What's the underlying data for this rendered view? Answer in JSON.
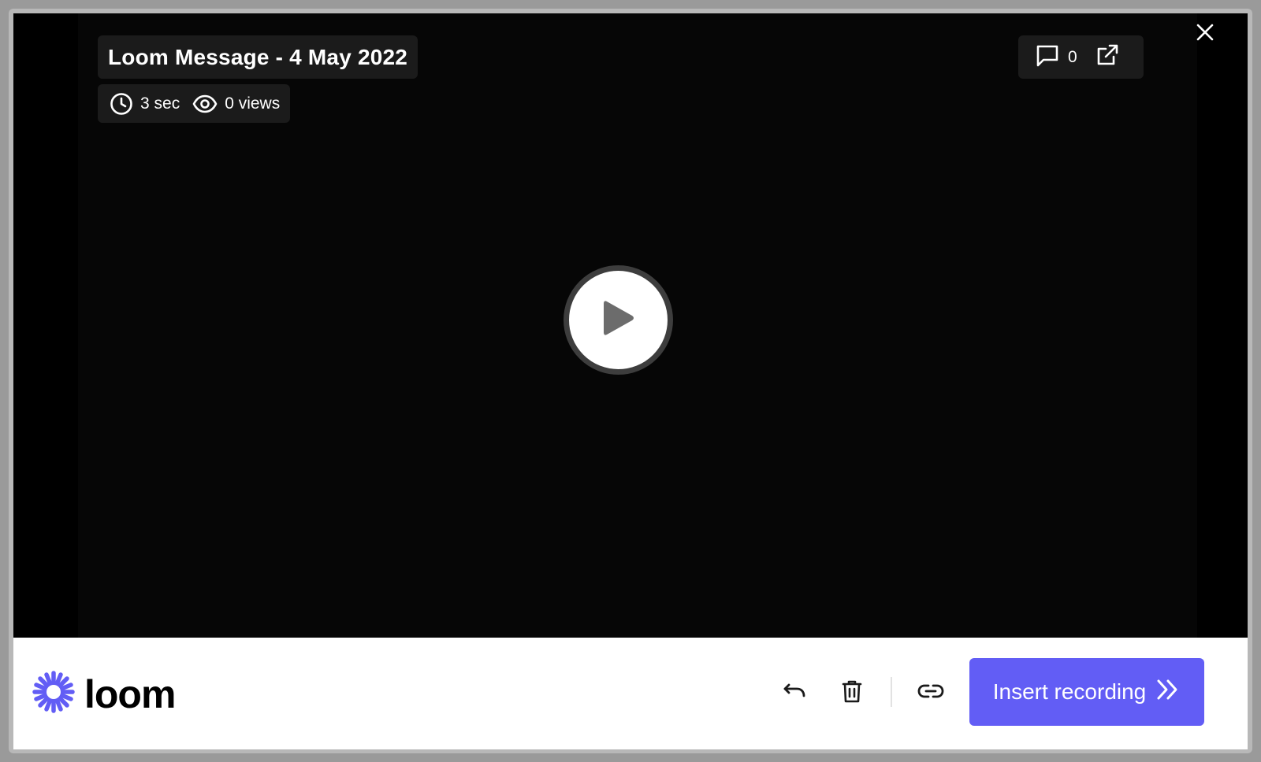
{
  "video": {
    "title": "Loom Message - 4 May 2022",
    "duration": "3 sec",
    "views": "0 views",
    "comment_count": "0"
  },
  "icons": {
    "close": "close-icon",
    "duration": "clock-icon",
    "views": "eye-icon",
    "comments": "comment-icon",
    "open_external": "external-link-icon",
    "play": "play-icon",
    "undo": "undo-icon",
    "delete": "trash-icon",
    "copy_link": "link-icon",
    "insert": "double-chevron-right-icon"
  },
  "footer": {
    "logo_text": "loom",
    "insert_label": "Insert recording"
  },
  "colors": {
    "accent": "#625df5",
    "video_bg": "#000000",
    "overlay_bg": "#1b1b1b"
  }
}
